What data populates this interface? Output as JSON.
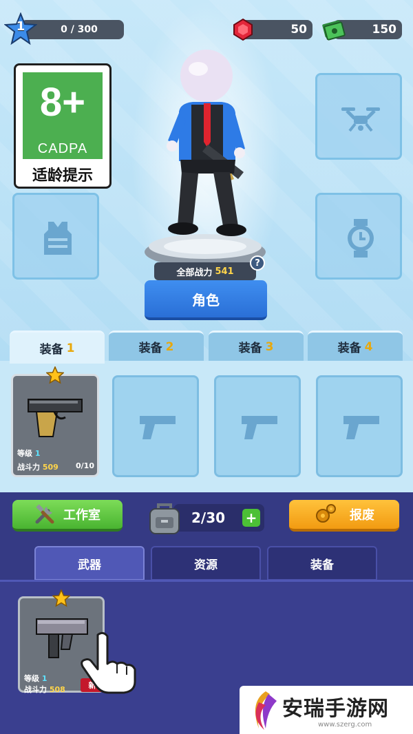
{
  "header": {
    "level": "1",
    "xp_text": "0 / 300",
    "gems": "50",
    "cash": "150"
  },
  "age_rating": {
    "age": "8+",
    "org": "CADPA",
    "tip": "适龄提示"
  },
  "character": {
    "power_label": "全部战力",
    "power_value": "541",
    "help_glyph": "?",
    "role_button": "角色"
  },
  "equipment_tabs": [
    {
      "label": "装备",
      "num": "1",
      "active": true
    },
    {
      "label": "装备",
      "num": "2",
      "active": false
    },
    {
      "label": "装备",
      "num": "3",
      "active": false
    },
    {
      "label": "装备",
      "num": "4",
      "active": false
    }
  ],
  "equipped_weapon": {
    "level_label": "等级",
    "level": "1",
    "power_label": "战斗力",
    "power": "509",
    "count": "0/10"
  },
  "toolbar": {
    "workshop": "工作室",
    "capacity": "2/30",
    "plus": "+",
    "scrap": "报废"
  },
  "inventory_tabs": [
    {
      "label": "武器",
      "active": true
    },
    {
      "label": "资源",
      "active": false
    },
    {
      "label": "装备",
      "active": false
    }
  ],
  "inventory_items": [
    {
      "level_label": "等级",
      "level": "1",
      "power_label": "战斗力",
      "power": "508",
      "badge": "新"
    }
  ],
  "watermark": {
    "name": "安瑞手游网",
    "url": "www.szerg.com"
  },
  "colors": {
    "accent_blue": "#2a6fd6",
    "green": "#4caf50",
    "orange": "#f29b12",
    "inventory_bg": "#3a3f8f",
    "badge_red": "#c4182b",
    "gold": "#ffd54a"
  },
  "icons": [
    "level-star-icon",
    "gem-icon",
    "cash-icon",
    "vest-icon",
    "drone-icon",
    "watch-icon",
    "pistol-icon",
    "smg-icon",
    "backpack-icon",
    "tools-icon",
    "gears-icon",
    "tap-hand-icon"
  ]
}
